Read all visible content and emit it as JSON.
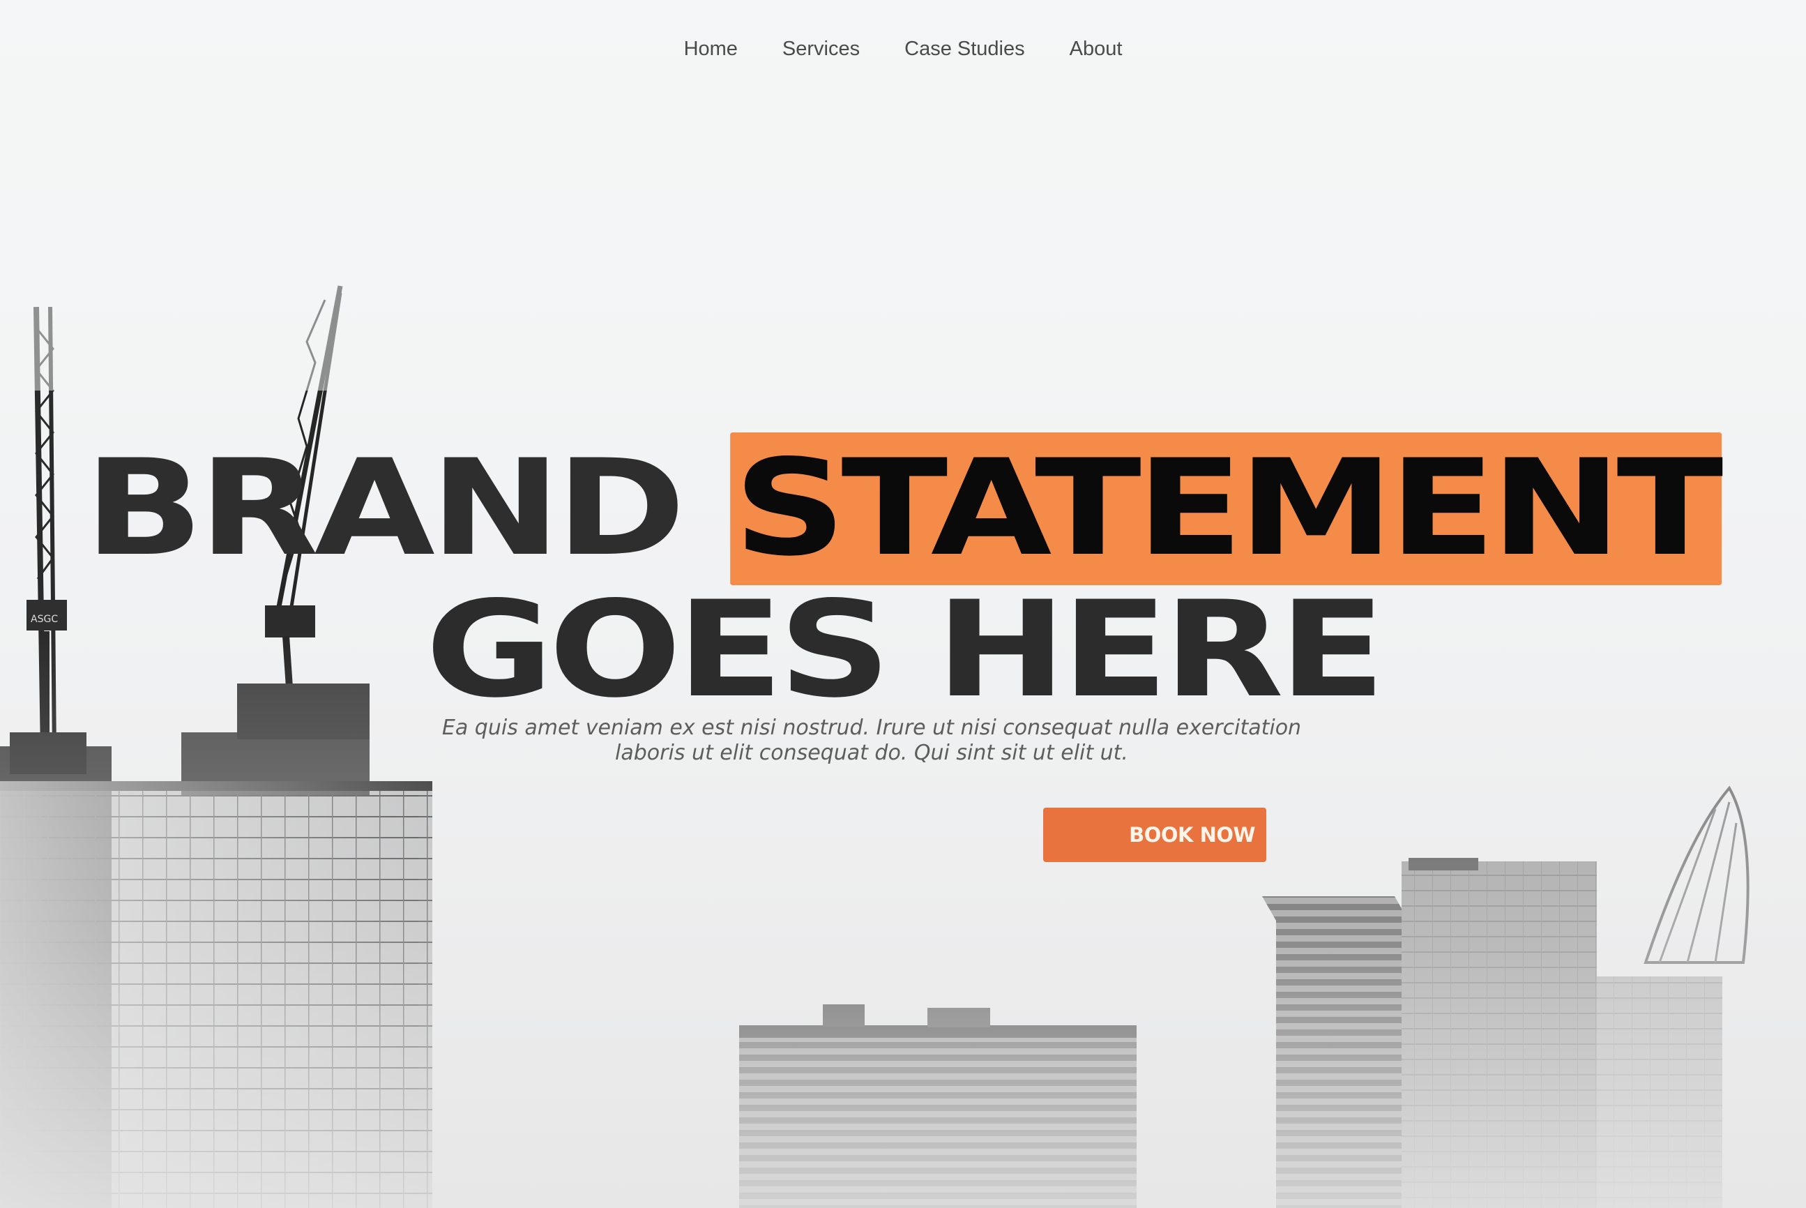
{
  "nav": {
    "items": [
      {
        "label": "Home"
      },
      {
        "label": "Services"
      },
      {
        "label": "Case Studies"
      },
      {
        "label": "About"
      }
    ]
  },
  "hero": {
    "headline_word1": "BRAND",
    "headline_highlight": "STATEMENT",
    "headline_line2": "GOES HERE",
    "subtitle": "Ea quis amet veniam ex est nisi nostrud. Irure ut nisi consequat nulla exercitation laboris ut elit consequat do. Qui sint sit ut elit ut.",
    "cta_label": "BOOK NOW",
    "crane_sign": "ASGC"
  },
  "colors": {
    "accent": "#f58b48",
    "cta_background": "#e8733f",
    "headline_text": "#2c2c2c",
    "nav_text": "#4a4a4a",
    "background": "#f1f2f3"
  }
}
